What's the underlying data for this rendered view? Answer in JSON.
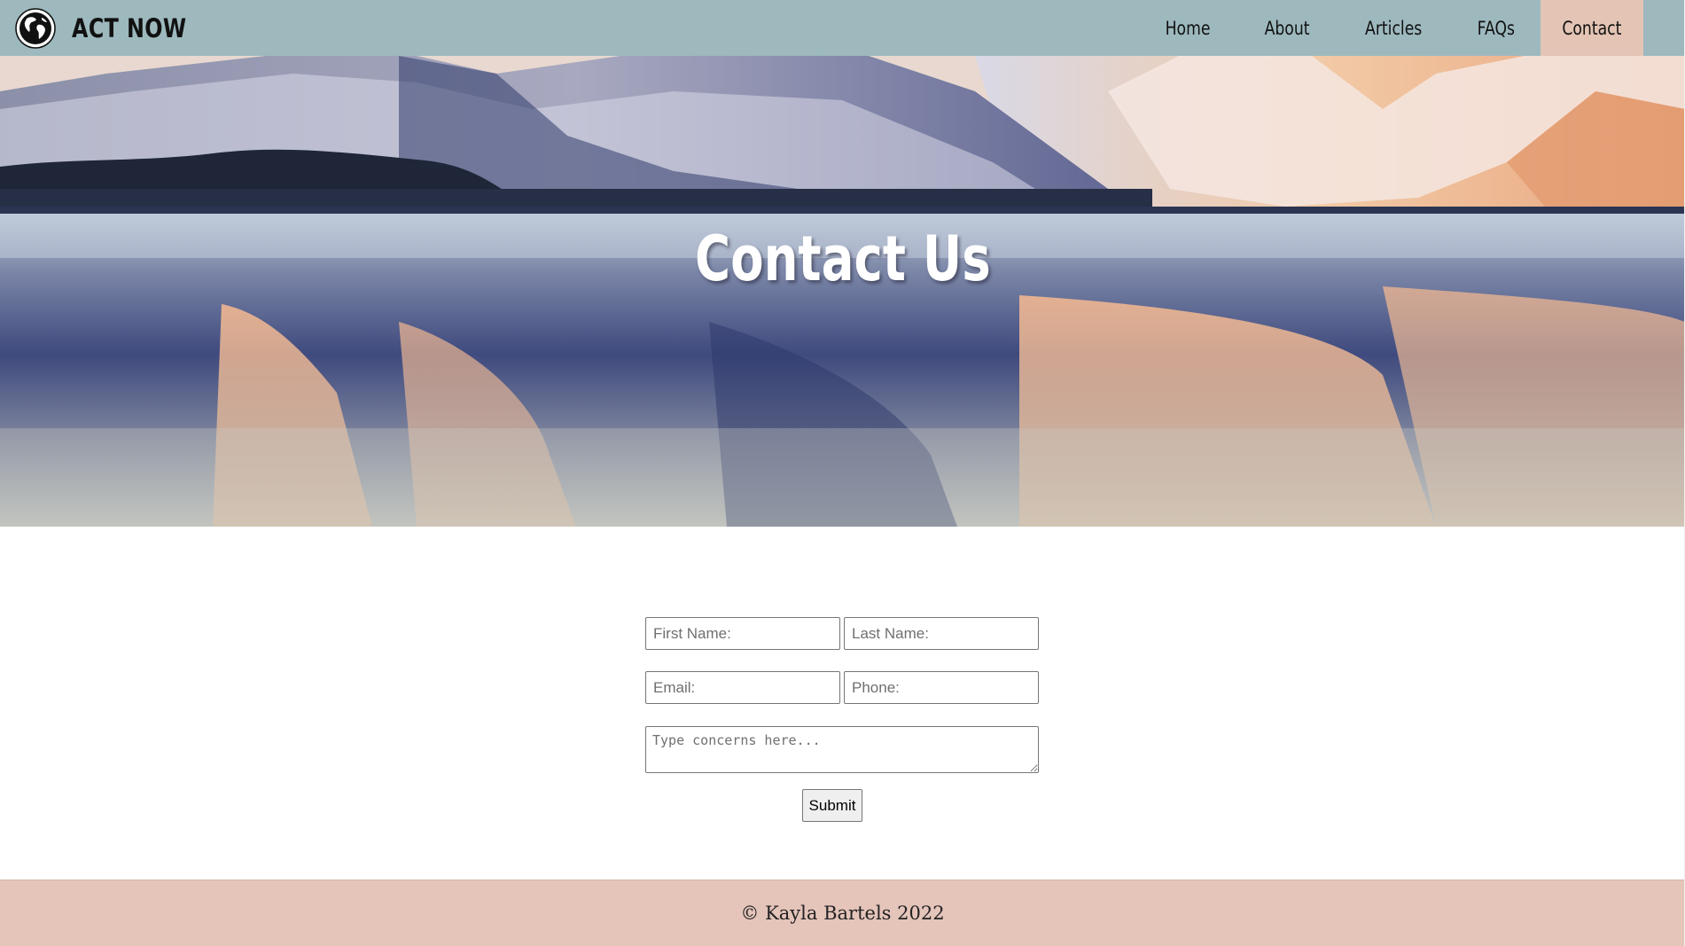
{
  "nav": {
    "brand": "ACT NOW",
    "logo_icon": "globe-icon",
    "links": [
      {
        "label": "Home",
        "active": false
      },
      {
        "label": "About",
        "active": false
      },
      {
        "label": "Articles",
        "active": false
      },
      {
        "label": "FAQs",
        "active": false
      },
      {
        "label": "Contact",
        "active": true
      }
    ]
  },
  "hero": {
    "title": "Contact Us"
  },
  "form": {
    "first_name_placeholder": "First Name:",
    "last_name_placeholder": "Last Name:",
    "email_placeholder": "Email:",
    "phone_placeholder": "Phone:",
    "concerns_placeholder": "Type concerns here...",
    "submit_label": "Submit"
  },
  "footer": {
    "text": "© Kayla Bartels 2022"
  },
  "colors": {
    "nav_bg": "#9db9be",
    "active_tab_bg": "#e3c4b5",
    "footer_bg": "#e5c4ba"
  }
}
